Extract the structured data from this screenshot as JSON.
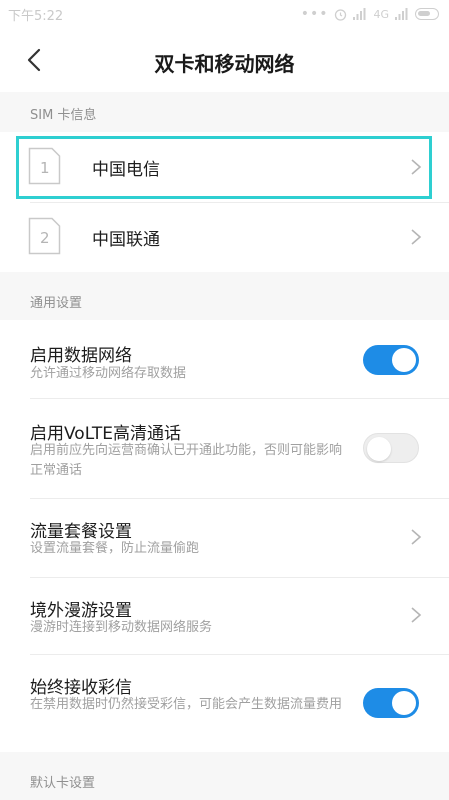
{
  "status_bar": {
    "time": "下午5:22",
    "network": "4G",
    "dots": "•••"
  },
  "header": {
    "title": "双卡和移动网络"
  },
  "sim_section": {
    "label": "SIM 卡信息",
    "cards": [
      {
        "slot": "1",
        "carrier": "中国电信"
      },
      {
        "slot": "2",
        "carrier": "中国联通"
      }
    ]
  },
  "general_section": {
    "label": "通用设置",
    "items": [
      {
        "title": "启用数据网络",
        "desc": "允许通过移动网络存取数据",
        "control": "toggle",
        "enabled": true
      },
      {
        "title": "启用VoLTE高清通话",
        "desc": "启用前应先向运营商确认已开通此功能，否则可能影响正常通话",
        "control": "toggle",
        "enabled": false
      },
      {
        "title": "流量套餐设置",
        "desc": "设置流量套餐，防止流量偷跑",
        "control": "chevron"
      },
      {
        "title": "境外漫游设置",
        "desc": "漫游时连接到移动数据网络服务",
        "control": "chevron"
      },
      {
        "title": "始终接收彩信",
        "desc": "在禁用数据时仍然接受彩信，可能会产生数据流量费用",
        "control": "toggle",
        "enabled": true
      }
    ]
  },
  "default_section": {
    "label": "默认卡设置"
  },
  "colors": {
    "accent": "#1e8ce6",
    "highlight": "#2ecfd1"
  }
}
